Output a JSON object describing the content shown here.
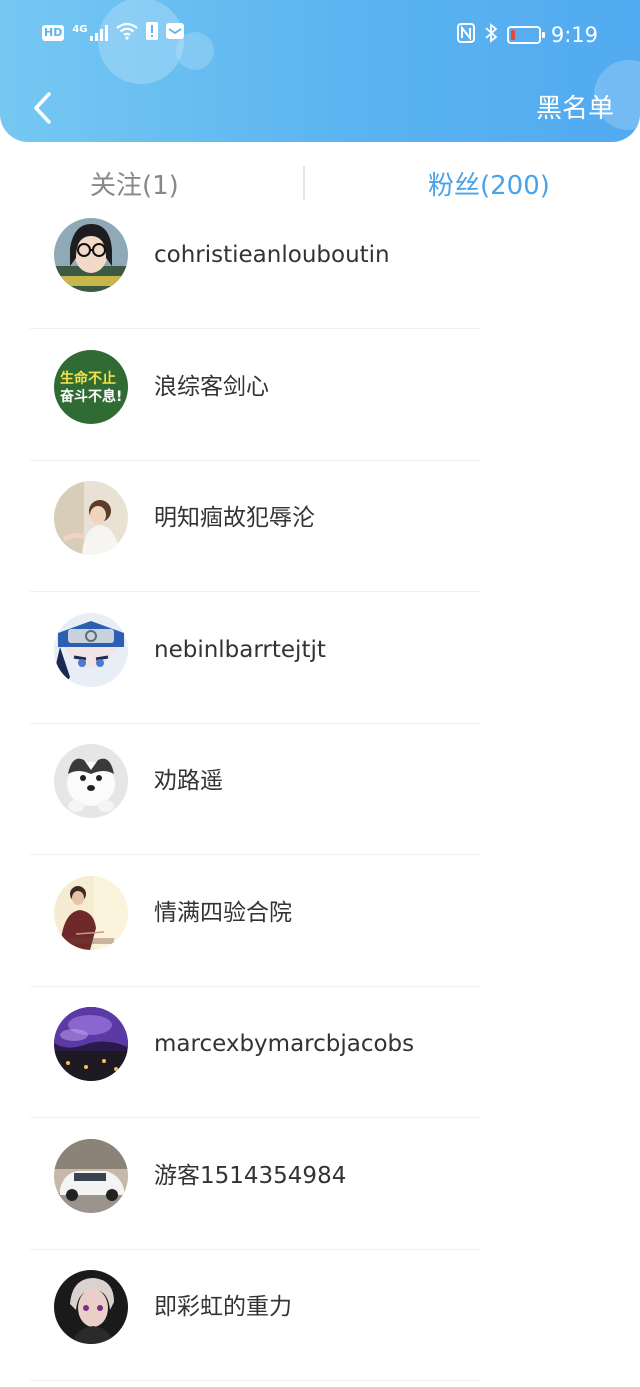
{
  "status_bar": {
    "hd": "HD",
    "network": "4G",
    "time": "9:19",
    "battery_color": "#e8473f"
  },
  "header": {
    "action_label": "黑名单",
    "back_icon": "chevron-left-icon"
  },
  "tabs": {
    "following_label": "关注(1)",
    "fans_label": "粉丝(200)",
    "active_color": "#4aa3e8",
    "inactive_color": "#888888"
  },
  "fans": [
    {
      "name": "cohristieanlouboutin"
    },
    {
      "name": "浪综客剑心"
    },
    {
      "name": "明知痼故犯辱沦"
    },
    {
      "name": "nebinlbarrtejtjt"
    },
    {
      "name": "劝路遥"
    },
    {
      "name": "情满四验合院"
    },
    {
      "name": "marcexbymarcbjacobs"
    },
    {
      "name": "游客1514354984"
    },
    {
      "name": "即彩虹的重力"
    }
  ],
  "avatar_texts": {
    "banner_line1": "生命不止",
    "banner_line2": "奋斗不息!"
  }
}
